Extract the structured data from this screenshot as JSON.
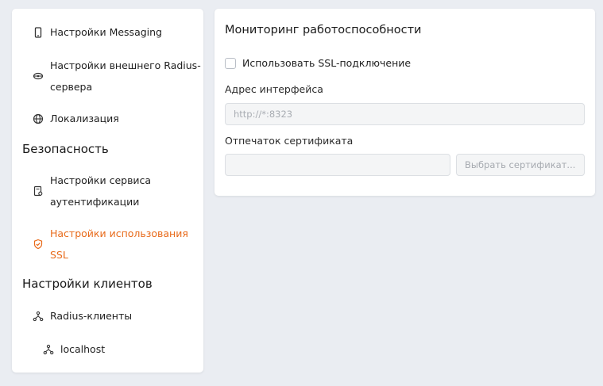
{
  "sidebar": {
    "items": [
      {
        "label": "Настройки Messaging",
        "icon": "phone-icon"
      },
      {
        "label_line1": "Настройки внешнего Radius-",
        "label_line2": "сервера",
        "icon": "radius-server-icon"
      },
      {
        "label": "Локализация",
        "icon": "globe-icon"
      }
    ],
    "security_heading": "Безопасность",
    "security_items": [
      {
        "label_line1": "Настройки сервиса",
        "label_line2": "аутентификации",
        "icon": "auth-service-icon"
      },
      {
        "label_line1": "Настройки использования",
        "label_line2": "SSL",
        "icon": "shield-check-icon",
        "active": true
      }
    ],
    "clients_heading": "Настройки клиентов",
    "clients_items": [
      {
        "label": "Radius-клиенты",
        "icon": "network-icon"
      },
      {
        "label": "localhost",
        "icon": "network-icon"
      }
    ]
  },
  "panel": {
    "title": "Мониторинг работоспособности",
    "ssl_checkbox_label": "Использовать SSL-подключение",
    "ssl_checked": false,
    "interface_label": "Адрес интерфейса",
    "interface_placeholder": "http://*:8323",
    "cert_label": "Отпечаток сертификата",
    "cert_value": "",
    "choose_cert_button": "Выбрать сертификат..."
  },
  "colors": {
    "accent": "#e86a1a",
    "background": "#eaedf2",
    "card": "#ffffff"
  }
}
